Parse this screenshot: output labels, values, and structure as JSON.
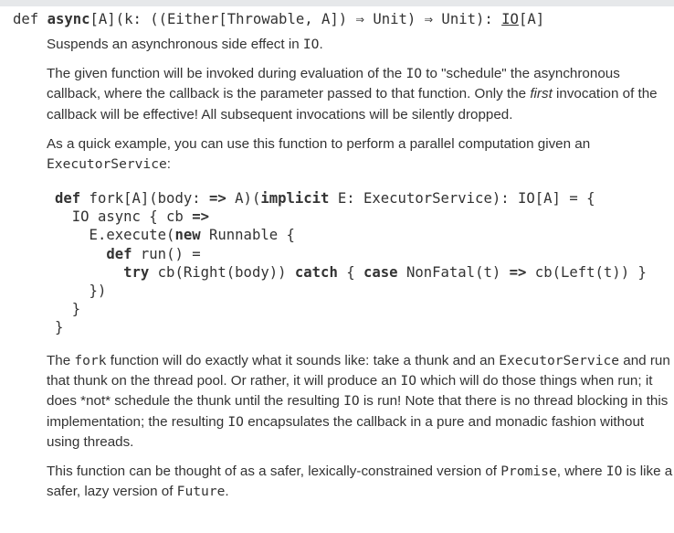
{
  "signature": [
    {
      "t": "def "
    },
    {
      "t": "async",
      "b": true
    },
    {
      "t": "[A](k: ((Either[Throwable, A]) ⇒ Unit) ⇒ Unit): "
    },
    {
      "t": "IO",
      "link": true
    },
    {
      "t": "[A]"
    }
  ],
  "paragraphs_before": [
    [
      {
        "t": "Suspends an asynchronous side effect in "
      },
      {
        "t": "IO",
        "code": true
      },
      {
        "t": "."
      }
    ],
    [
      {
        "t": "The given function will be invoked during evaluation of the "
      },
      {
        "t": "IO",
        "code": true
      },
      {
        "t": " to \"schedule\" the asynchronous callback, where the callback is the parameter passed to that function. Only the "
      },
      {
        "t": "first",
        "em": true
      },
      {
        "t": " invocation of the callback will be effective! All subsequent invocations will be silently dropped."
      }
    ],
    [
      {
        "t": "As a quick example, you can use this function to perform a parallel computation given an "
      },
      {
        "t": "ExecutorService",
        "code": true
      },
      {
        "t": ":"
      }
    ]
  ],
  "code_lines": [
    [
      {
        "t": "def",
        "b": true
      },
      {
        "t": " fork[A](body: "
      },
      {
        "t": "=>",
        "b": true
      },
      {
        "t": " A)("
      },
      {
        "t": "implicit",
        "b": true
      },
      {
        "t": " E: ExecutorService): IO[A] = {"
      }
    ],
    [
      {
        "t": "  IO async { cb "
      },
      {
        "t": "=>",
        "b": true
      }
    ],
    [
      {
        "t": "    E.execute("
      },
      {
        "t": "new",
        "b": true
      },
      {
        "t": " Runnable {"
      }
    ],
    [
      {
        "t": "      "
      },
      {
        "t": "def",
        "b": true
      },
      {
        "t": " run() ="
      }
    ],
    [
      {
        "t": "        "
      },
      {
        "t": "try",
        "b": true
      },
      {
        "t": " cb(Right(body)) "
      },
      {
        "t": "catch",
        "b": true
      },
      {
        "t": " { "
      },
      {
        "t": "case",
        "b": true
      },
      {
        "t": " NonFatal(t) "
      },
      {
        "t": "=>",
        "b": true
      },
      {
        "t": " cb(Left(t)) }"
      }
    ],
    [
      {
        "t": "    })"
      }
    ],
    [
      {
        "t": "  }"
      }
    ],
    [
      {
        "t": "}"
      }
    ]
  ],
  "paragraphs_after": [
    [
      {
        "t": "The "
      },
      {
        "t": "fork",
        "code": true
      },
      {
        "t": " function will do exactly what it sounds like: take a thunk and an "
      },
      {
        "t": "ExecutorService",
        "code": true
      },
      {
        "t": " and run that thunk on the thread pool. Or rather, it will produce an "
      },
      {
        "t": "IO",
        "code": true
      },
      {
        "t": " which will do those things when run; it does *not* schedule the thunk until the resulting "
      },
      {
        "t": "IO",
        "code": true
      },
      {
        "t": " is run! Note that there is no thread blocking in this implementation; the resulting "
      },
      {
        "t": "IO",
        "code": true
      },
      {
        "t": " encapsulates the callback in a pure and monadic fashion without using threads."
      }
    ],
    [
      {
        "t": "This function can be thought of as a safer, lexically-constrained version of "
      },
      {
        "t": "Promise",
        "code": true
      },
      {
        "t": ", where "
      },
      {
        "t": "IO",
        "code": true
      },
      {
        "t": " is like a safer, lazy version of "
      },
      {
        "t": "Future",
        "code": true
      },
      {
        "t": "."
      }
    ]
  ]
}
